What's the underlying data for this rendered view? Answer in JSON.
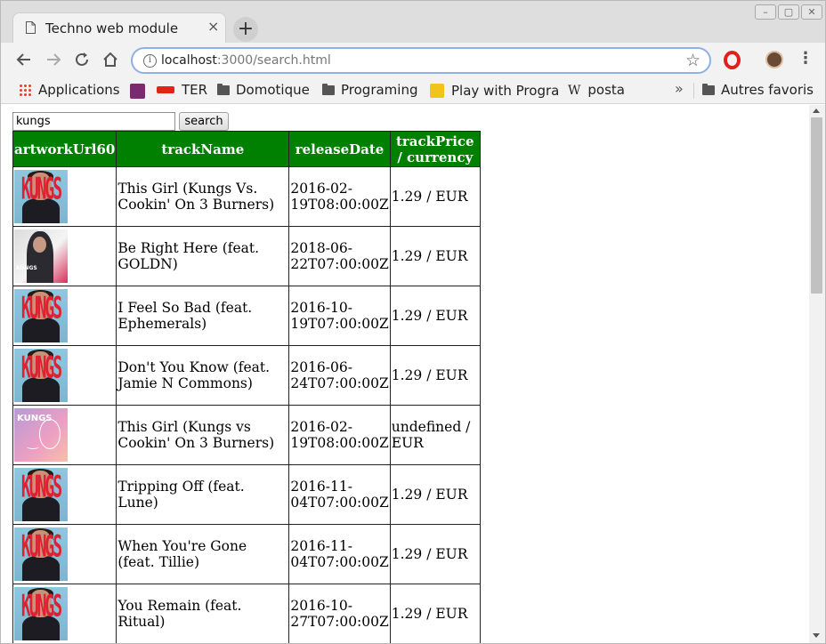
{
  "browser": {
    "tab_title": "Techno web module",
    "tab_close": "×",
    "new_tab": "+",
    "url_host": "localhost",
    "url_path": ":3000/search.html",
    "icons": [
      "back-icon",
      "forward-icon",
      "reload-icon",
      "home-icon",
      "info-icon",
      "star-icon",
      "opera-icon",
      "avatar",
      "menu-icon"
    ]
  },
  "bookmarks": {
    "items": [
      {
        "label": "Applications",
        "icon": "apps-icon"
      },
      {
        "label": "",
        "icon": "site-logo-icon"
      },
      {
        "label": "TER",
        "icon": "sncf-logo-icon"
      },
      {
        "label": "Domotique",
        "icon": "folder-icon"
      },
      {
        "label": "Programing",
        "icon": "folder-icon"
      },
      {
        "label": "Play with Progra",
        "icon": "pencil-logo-icon"
      },
      {
        "label": "posta",
        "icon": "wikipedia-icon"
      }
    ],
    "overflow": "»",
    "other": "Autres favoris",
    "wiki_glyph": "W"
  },
  "search": {
    "value": "kungs",
    "button_label": "search"
  },
  "table": {
    "headers": {
      "artwork": "artworkUrl60",
      "track": "trackName",
      "release": "releaseDate",
      "price": "trackPrice / currency"
    },
    "rows": [
      {
        "art": "a",
        "trackName": "This Girl (Kungs Vs. Cookin' On 3 Burners)",
        "releaseDate": "2016-02-19T08:00:00Z",
        "price": "1.29 / EUR"
      },
      {
        "art": "b",
        "trackName": "Be Right Here (feat. GOLDN)",
        "releaseDate": "2018-06-22T07:00:00Z",
        "price": "1.29 / EUR"
      },
      {
        "art": "a",
        "trackName": "I Feel So Bad (feat. Ephemerals)",
        "releaseDate": "2016-10-19T07:00:00Z",
        "price": "1.29 / EUR"
      },
      {
        "art": "a",
        "trackName": "Don't You Know (feat. Jamie N Commons)",
        "releaseDate": "2016-06-24T07:00:00Z",
        "price": "1.29 / EUR"
      },
      {
        "art": "c",
        "trackName": "This Girl (Kungs vs Cookin' On 3 Burners)",
        "releaseDate": "2016-02-19T08:00:00Z",
        "price": "undefined / EUR"
      },
      {
        "art": "a",
        "trackName": "Tripping Off (feat. Lune)",
        "releaseDate": "2016-11-04T07:00:00Z",
        "price": "1.29 / EUR"
      },
      {
        "art": "a",
        "trackName": "When You're Gone (feat. Tillie)",
        "releaseDate": "2016-11-04T07:00:00Z",
        "price": "1.29 / EUR"
      },
      {
        "art": "a",
        "trackName": "You Remain (feat. Ritual)",
        "releaseDate": "2016-10-27T07:00:00Z",
        "price": "1.29 / EUR"
      }
    ],
    "artwork_text": {
      "a": "KUNGS",
      "b": "KUNGS",
      "c": "KUNGS"
    }
  },
  "colors": {
    "header_bg": "#008000",
    "header_text": "#ffffff",
    "omnibox_border": "#8fb0e6"
  }
}
